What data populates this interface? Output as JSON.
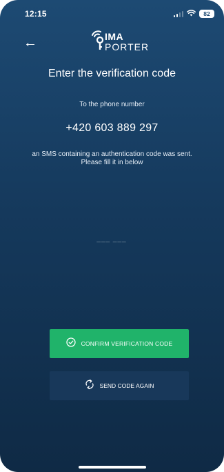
{
  "status_bar": {
    "time": "12:15",
    "battery": "82"
  },
  "header": {
    "logo_line1": "IMA",
    "logo_line2": "PORTER"
  },
  "main": {
    "title": "Enter the verification code",
    "intro": "To the phone number",
    "phone_number": "+420 603 889 297",
    "sms_text": "an SMS containing an authentication code was sent. Please fill it in below",
    "code_placeholder": "___ ___"
  },
  "buttons": {
    "confirm_label": "CONFIRM VERIFICATION CODE",
    "resend_label": "SEND CODE AGAIN"
  },
  "icons": {
    "back": "back-arrow-icon",
    "confirm": "check-circle-icon",
    "resend": "refresh-icon"
  },
  "colors": {
    "background_top": "#1d4a73",
    "background_bottom": "#0f2a45",
    "confirm_button": "#20b36a",
    "resend_button": "#18385a"
  }
}
